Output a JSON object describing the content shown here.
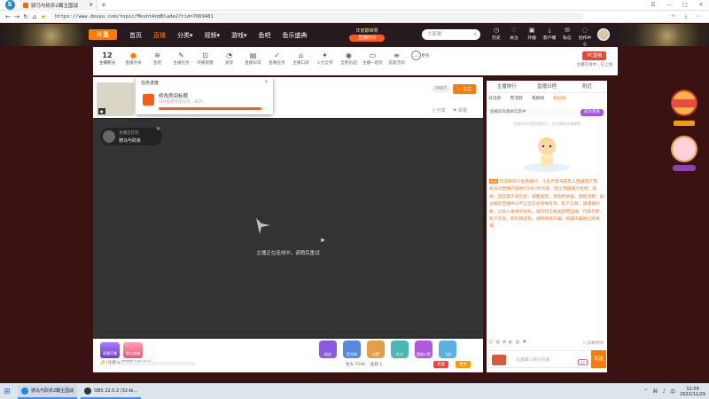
{
  "browser": {
    "tab_title": "骑马与砍杀2霸主国战",
    "url": "https://www.douyu.com/topic/MountAndBlade2?rid=7669481"
  },
  "site": {
    "logo": "斗鱼",
    "menu": [
      "首页",
      "直播",
      "分类",
      "视频",
      "游戏",
      "鱼吧",
      "鱼乐盛典"
    ],
    "active_menu": "直播",
    "event_label": "年度巅峰赛",
    "event_pill": "直播时间",
    "search_placeholder": "大家都",
    "top_icons": [
      "历史",
      "关注",
      "开播",
      "客户端",
      "私信",
      "创作中心"
    ]
  },
  "categories": [
    {
      "icon": "12",
      "label": "主播积分"
    },
    {
      "icon": "●",
      "label": "直播开关"
    },
    {
      "icon": "≋",
      "label": "鱼吧"
    },
    {
      "icon": "✎",
      "label": "主播任务"
    },
    {
      "icon": "⊡",
      "label": "开播提醒"
    },
    {
      "icon": "◔",
      "label": "发现"
    },
    {
      "icon": "▤",
      "label": "直播日常"
    },
    {
      "icon": "✓",
      "label": "鱼粮任务"
    },
    {
      "icon": "⌂",
      "label": "主播口袋"
    },
    {
      "icon": "✦",
      "label": "火力全开"
    },
    {
      "icon": "◉",
      "label": "全民乐园"
    },
    {
      "icon": "▭",
      "label": "主播一起玩"
    },
    {
      "icon": "≡",
      "label": "答题活动"
    },
    {
      "icon": "…",
      "label": "更多"
    }
  ],
  "pc_button": "PC直播",
  "pc_button_sub": "主播在线中，已上线",
  "stream": {
    "follow_count": "3467",
    "follow_label": "关注",
    "share": "分享",
    "report": "举报"
  },
  "popup": {
    "title": "任务进度",
    "task": "修改房间标题",
    "progress": "100鱼翅完成任务（未开）",
    "progress_fraction": 0.95
  },
  "player": {
    "badge_line1": "主播正在玩",
    "badge_line2": "骑马与砍杀",
    "message": "主播正在连线中，请稍后重试"
  },
  "giftbar": {
    "left_buttons": [
      "直播开播",
      "鱼丸商城"
    ],
    "tip": "[注意]",
    "tip2": "@可领取飞机(0/2)",
    "gifts": [
      "粉丝",
      "荧光棒",
      "火箭",
      "办卡",
      "超级火箭",
      "飞机"
    ],
    "stats": [
      "鱼丸 7248",
      "鱼翅 1"
    ],
    "buy": "充值",
    "more": "更多"
  },
  "chat": {
    "tabs": [
      "主播排行",
      "直播日程",
      "附近"
    ],
    "subtabs": [
      "日活跃",
      "周活跃",
      "贡献榜",
      "粉丝榜"
    ],
    "notice": "加载房间基本信息中",
    "notice_btn": "成为贵族",
    "empty": "主播尚未设置直播简介，给主播发送弹幕吧",
    "welcome_tag": "系统",
    "welcome": "欢迎来到斗鱼直播间。斗鱼严禁未成年人直播或打赏，依法对直播内容进行24小时巡查，禁止传播暴力色情、低俗、违禁等不良信息，如若发现，请及时举报。理性消费，如主播在直播中以不正当方式诱导打赏、私下交易，请谨慎判断，以防人身财产损失。请勿轻信各类招聘征婚、代练代售、私下交易、刷礼物返现，谨防网络诈骗，如遇诈骗请立即举报。",
    "input_placeholder": "这里输入聊天内容",
    "level_tag": "LV",
    "send": "发送",
    "checkbox": "屏蔽特效"
  },
  "taskbar": {
    "tasks": [
      "骑马与砍杀2霸主国战",
      "OBS 22.0.2 (32-bi..."
    ],
    "time": "12:09",
    "date": "2022/11/29",
    "lang": "中"
  },
  "colors": {
    "accent": "#ff7a00",
    "nav_bg": "#241a1f",
    "player_bg": "#333333"
  }
}
